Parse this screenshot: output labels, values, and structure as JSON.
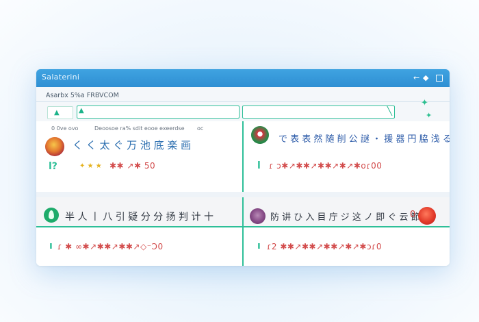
{
  "window": {
    "title": "Salaterini",
    "subtitle": "Asarbx 5%a FRBVCOM",
    "controls": {
      "back": "←",
      "fwd": "◆"
    }
  },
  "toolbar": {
    "tool_icon": "▲",
    "left_field_icon": "▲",
    "right_field_icon": "╲"
  },
  "decor": {
    "star_icon": "✦"
  },
  "cards": {
    "row_label": "0 0ve ovo",
    "row_label_2": "Deoosoe ra% sdit eooe exeerdse",
    "row_label_3": "oc",
    "top_left": {
      "avatar_icon": "avatar-icon",
      "heading": "く く 太 ぐ 万 池 底 楽 画",
      "mark": "l?",
      "stars": "✦ ★ ★",
      "value": "✱✱ ↗✱ 50"
    },
    "top_right": {
      "avatar_icon": "avatar-icon",
      "heading": "で 表 表 然 随 削 公 謎 ・ 援 器 円 脇 浅 る",
      "mark": "l",
      "value": "ɾ ɔ✱↗✱✱↗✱✱↗✱↗✱oɾ00"
    },
    "bottom_left": {
      "avatar_icon": "leaf-icon",
      "heading": "半 人 丨 八 引 疑 分 分 扬 判 计 十",
      "mark": "ı",
      "value": "ɾ ✱ ∞✱↗✱✱↗✱✱↗◇⁻Ɔ0"
    },
    "bottom_right": {
      "avatar_icon": "avatar-icon",
      "heading": "防 讲 ひ 入 目 庁 ジ 这 ノ 即 ぐ 云 節 )",
      "badge": "0",
      "mark": "ı",
      "value": "ɾ2 ✱✱↗✱✱↗✱✱↗✱↗✱ɔɾ0"
    }
  },
  "colors": {
    "accent": "#2ebf98",
    "titlebar": "#3fa3e1",
    "value_red": "#d24a4a",
    "heading_blue": "#2c6fb0"
  }
}
